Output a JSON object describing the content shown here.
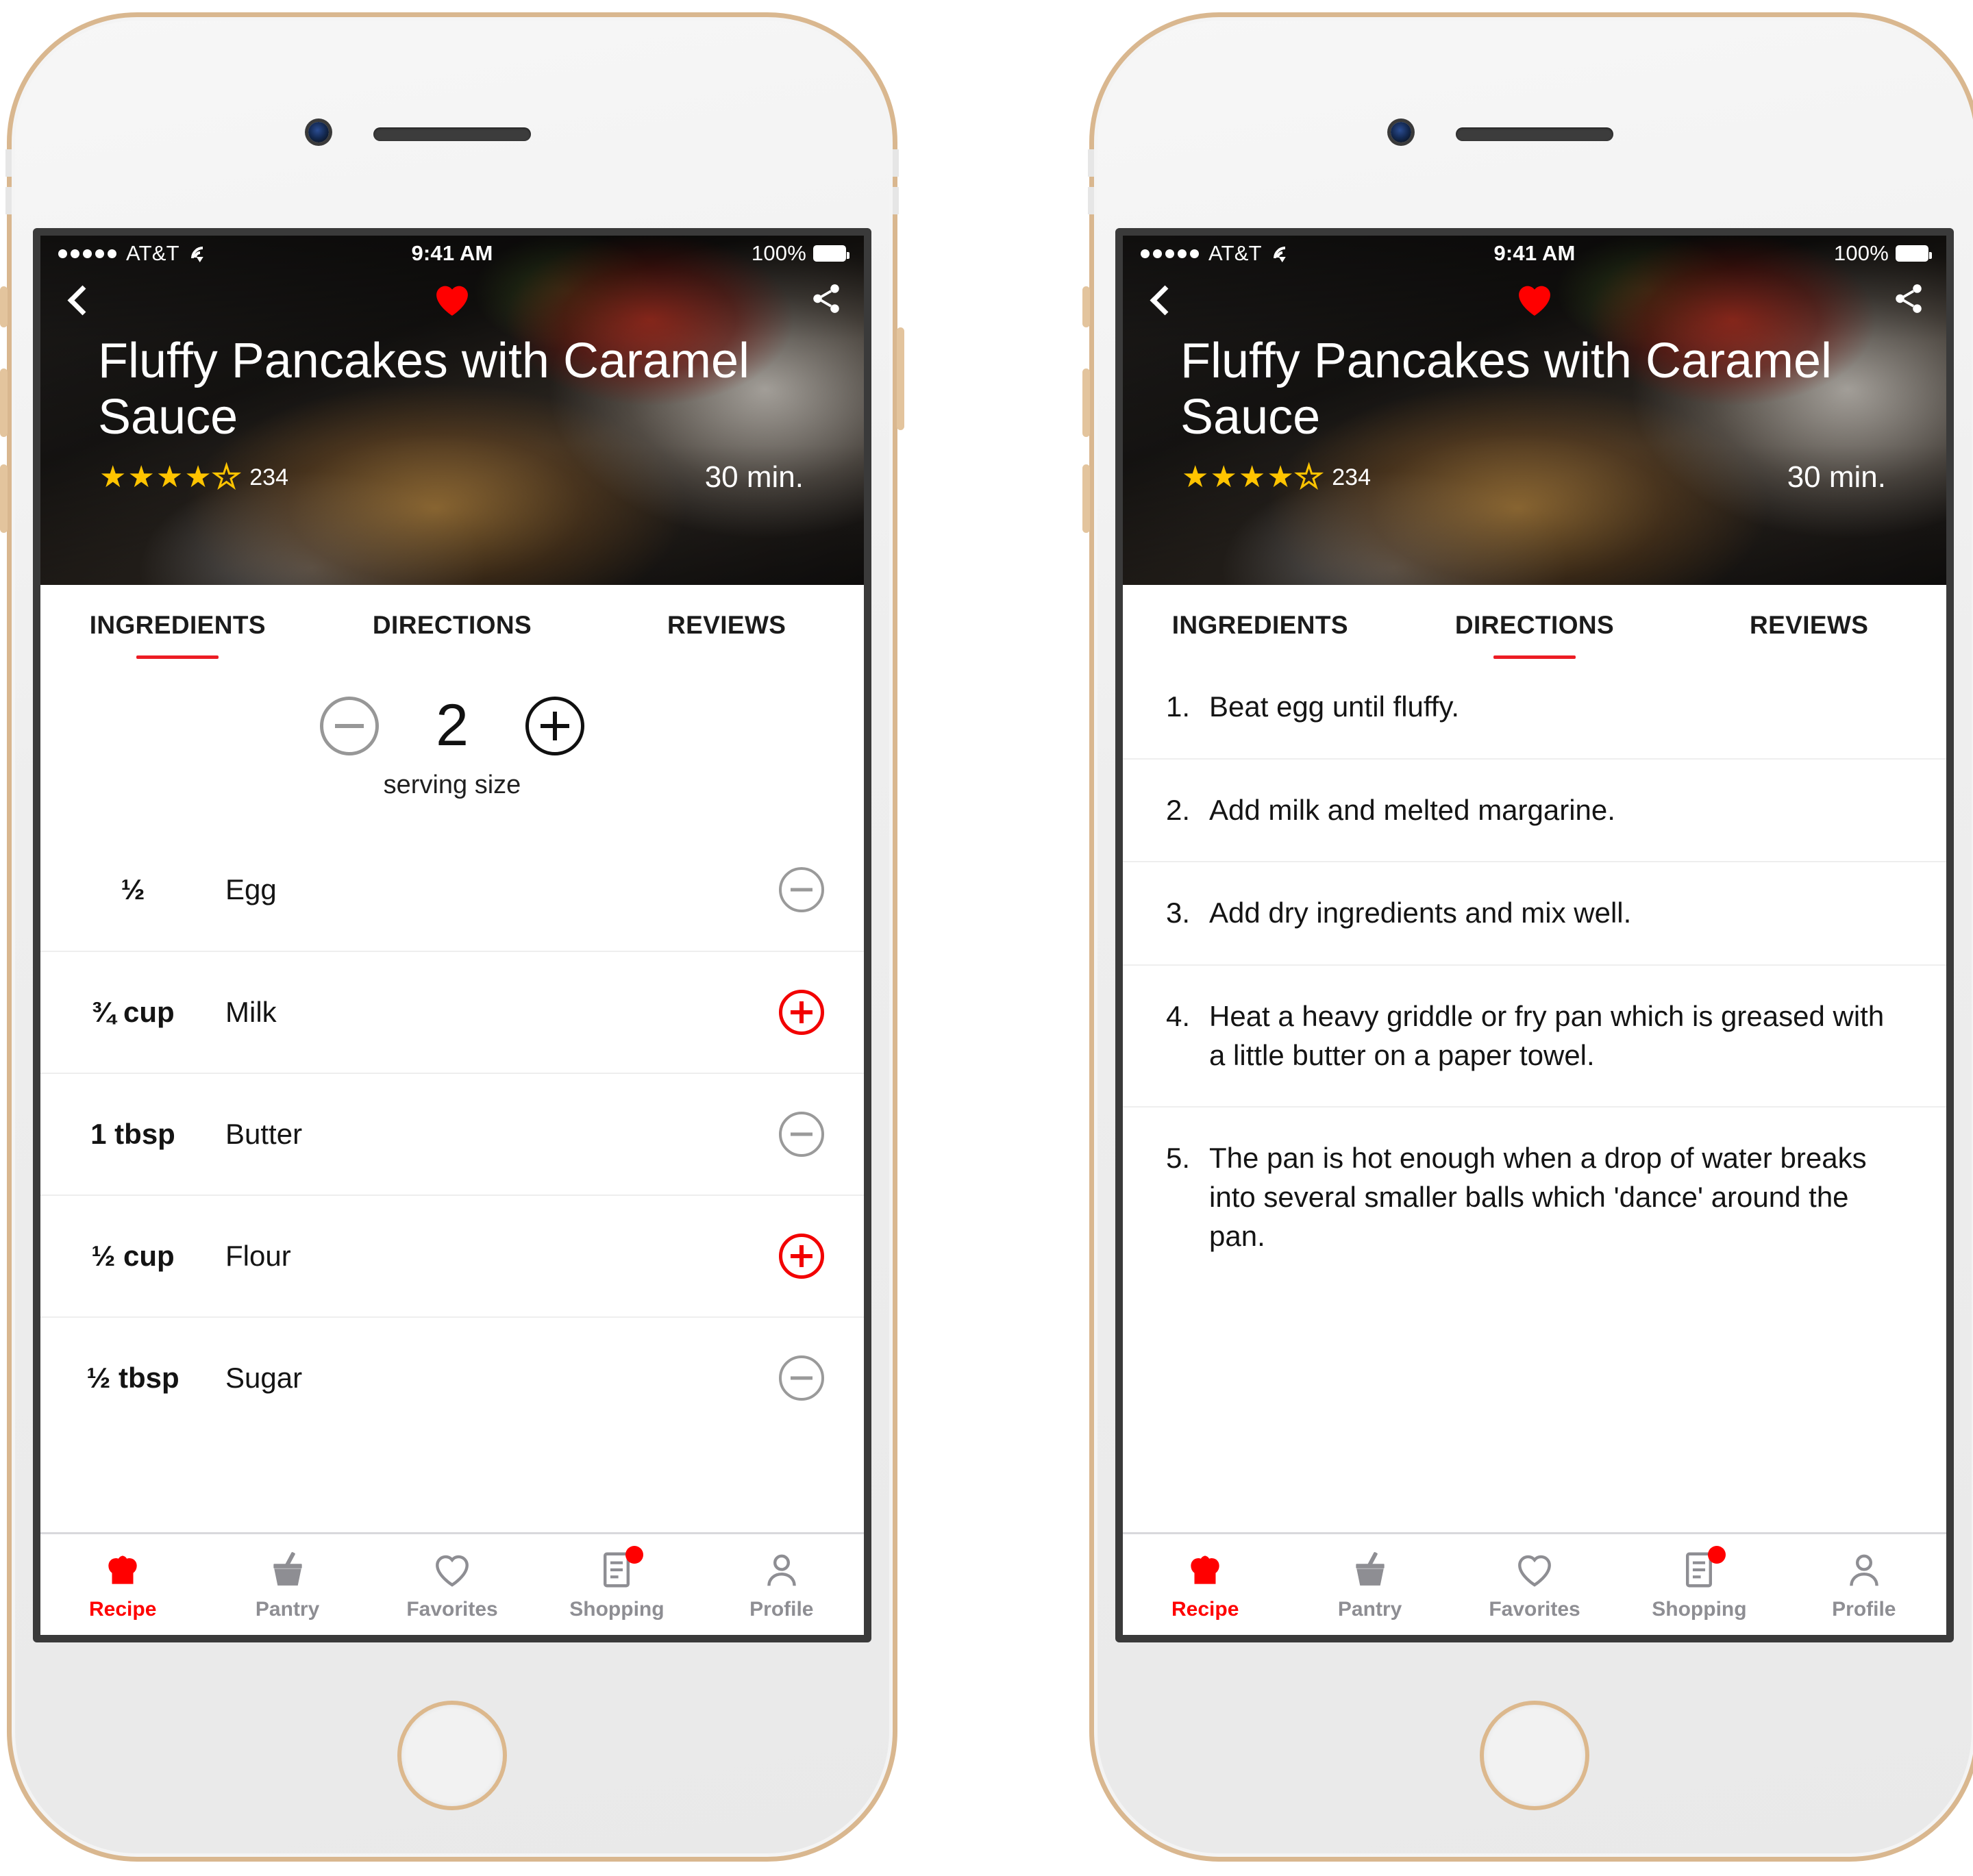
{
  "statusbar": {
    "signal_dots": 5,
    "carrier": "AT&T",
    "wifi_icon": "wifi-icon",
    "time": "9:41 AM",
    "battery_pct": "100%",
    "battery_icon": "battery-full-icon"
  },
  "hero": {
    "back_icon": "back-chevron-icon",
    "favorite_icon": "heart-filled-icon",
    "share_icon": "share-icon",
    "title": "Fluffy Pancakes with Caramel Sauce",
    "rating_stars_filled": 4,
    "rating_stars_total": 5,
    "rating_count": "234",
    "cook_time": "30 min."
  },
  "tabs": [
    {
      "label": "INGREDIENTS"
    },
    {
      "label": "DIRECTIONS"
    },
    {
      "label": "REVIEWS"
    }
  ],
  "left_phone": {
    "active_tab_index": 0,
    "serving": {
      "decrement_icon": "minus-circle-icon",
      "increment_icon": "plus-circle-icon",
      "count": "2",
      "label": "serving size"
    },
    "ingredients": [
      {
        "qty": "½",
        "name": "Egg",
        "action": "remove",
        "action_icon": "minus-circle-icon"
      },
      {
        "qty": "¾ cup",
        "name": "Milk",
        "action": "add",
        "action_icon": "plus-circle-icon"
      },
      {
        "qty": "1 tbsp",
        "name": "Butter",
        "action": "remove",
        "action_icon": "minus-circle-icon"
      },
      {
        "qty": "½ cup",
        "name": "Flour",
        "action": "add",
        "action_icon": "plus-circle-icon"
      },
      {
        "qty": "½ tbsp",
        "name": "Sugar",
        "action": "remove",
        "action_icon": "minus-circle-icon"
      }
    ]
  },
  "right_phone": {
    "active_tab_index": 1,
    "directions": [
      {
        "num": "1.",
        "text": "Beat egg until fluffy."
      },
      {
        "num": "2.",
        "text": "Add milk and melted margarine."
      },
      {
        "num": "3.",
        "text": "Add dry ingredients and mix well."
      },
      {
        "num": "4.",
        "text": "Heat a heavy griddle or fry pan which is greased with a little butter on a paper towel."
      },
      {
        "num": "5.",
        "text": "The pan is hot enough when a drop of water breaks into several smaller balls which 'dance' around the pan."
      }
    ]
  },
  "tabbar": [
    {
      "label": "Recipe",
      "icon": "chef-hat-icon",
      "active": true,
      "badge": false
    },
    {
      "label": "Pantry",
      "icon": "mortar-pestle-icon",
      "active": false,
      "badge": false
    },
    {
      "label": "Favorites",
      "icon": "heart-outline-icon",
      "active": false,
      "badge": false
    },
    {
      "label": "Shopping",
      "icon": "list-icon",
      "active": false,
      "badge": true
    },
    {
      "label": "Profile",
      "icon": "person-icon",
      "active": false,
      "badge": false
    }
  ],
  "colors": {
    "accent_red": "#ff0000",
    "underline_red": "#ec1c24",
    "star_yellow": "#ffc400",
    "inactive_gray": "#8e8e93"
  }
}
